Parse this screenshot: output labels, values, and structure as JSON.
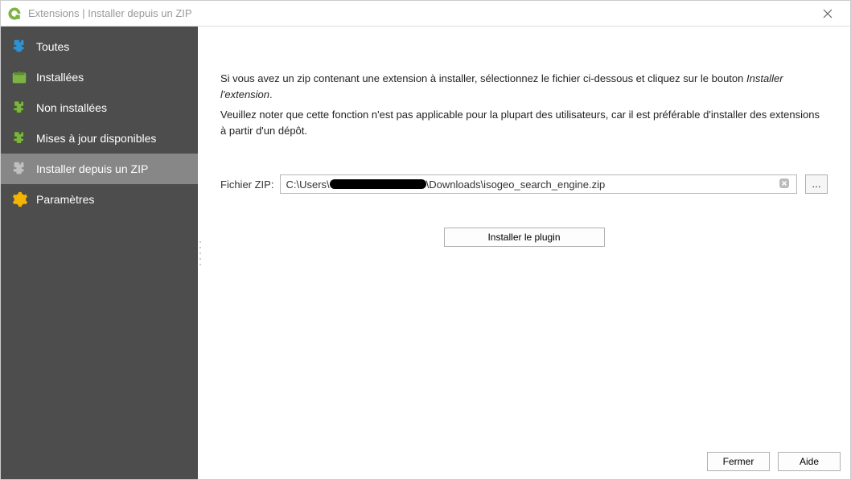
{
  "window": {
    "title": "Extensions | Installer depuis un ZIP"
  },
  "sidebar": {
    "items": [
      {
        "label": "Toutes",
        "icon": "puzzle-blue"
      },
      {
        "label": "Installées",
        "icon": "puzzle-box"
      },
      {
        "label": "Non installées",
        "icon": "puzzle-dark"
      },
      {
        "label": "Mises à jour disponibles",
        "icon": "puzzle-dark"
      },
      {
        "label": "Installer depuis un ZIP",
        "icon": "puzzle-gray"
      },
      {
        "label": "Paramètres",
        "icon": "gear"
      }
    ],
    "selected_index": 4
  },
  "main": {
    "intro_line1_a": "Si vous avez un zip contenant une extension à installer, sélectionnez le fichier ci-dessous et cliquez sur le bouton ",
    "intro_line1_b": "Installer l'extension",
    "intro_line1_c": ".",
    "intro_line2": "Veuillez noter que cette fonction n'est pas applicable pour la plupart des utilisateurs, car il est préférable d'installer des extensions à partir d'un dépôt.",
    "zip_label": "Fichier ZIP:",
    "zip_path_before": "C:\\Users\\",
    "zip_path_after": "\\Downloads\\isogeo_search_engine.zip",
    "browse_label": "…",
    "install_button": "Installer le plugin"
  },
  "footer": {
    "close": "Fermer",
    "help": "Aide"
  }
}
